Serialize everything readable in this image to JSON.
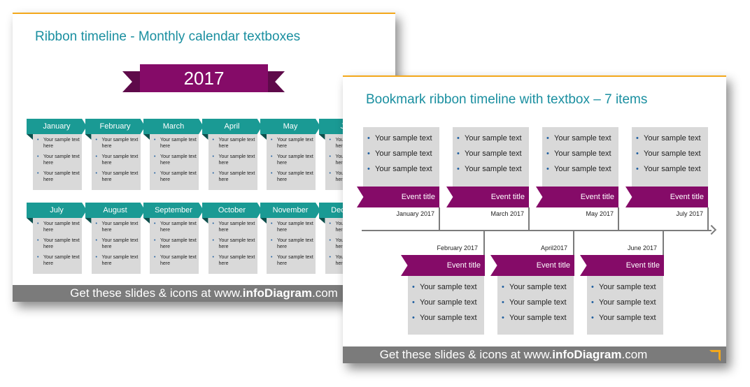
{
  "back_slide": {
    "title": "Ribbon timeline - Monthly calendar textboxes",
    "year": "2017",
    "months": [
      "January",
      "February",
      "March",
      "April",
      "May",
      "June",
      "July",
      "August",
      "September",
      "October",
      "November",
      "December"
    ],
    "bullet_text": "Your sample text here",
    "footer": {
      "prefix": "Get these slides & icons at www.",
      "brand": "infoDiagram",
      ".suffix": ".com",
      "suffix": ".com"
    }
  },
  "front_slide": {
    "title": "Bookmark ribbon timeline with textbox – 7 items",
    "bullet_text": "Your sample text",
    "top_events": [
      {
        "title": "Event title",
        "date": "January 2017"
      },
      {
        "title": "Event title",
        "date": "March 2017"
      },
      {
        "title": "Event title",
        "date": "May 2017"
      },
      {
        "title": "Event title",
        "date": "July 2017"
      }
    ],
    "bottom_events": [
      {
        "title": "Event title",
        "date": "February 2017"
      },
      {
        "title": "Event title",
        "date": "April2017"
      },
      {
        "title": "Event title",
        "date": "June 2017"
      }
    ],
    "footer": {
      "prefix": "Get these slides & icons at www.",
      "brand": "infoDiagram",
      "suffix": ".com"
    }
  },
  "colors": {
    "teal": "#1a9a94",
    "purple": "#850b68",
    "accent_orange": "#f3a81b",
    "box_gray": "#d9d9d9",
    "footer_gray": "#7b7b7b"
  }
}
